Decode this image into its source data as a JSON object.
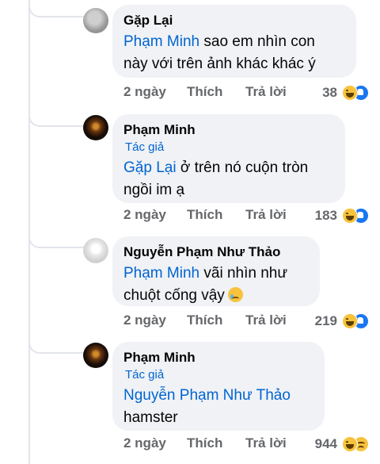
{
  "comments": [
    {
      "author": "Gặp Lại",
      "mention": "Phạm Minh",
      "text_line1": " sao em nhìn con",
      "text_line2": "này với trên ảnh khác khác ý",
      "time": "2 ngày",
      "like_label": "Thích",
      "reply_label": "Trả lời",
      "reaction_count": "38",
      "reactions": [
        "haha-icon",
        "like-icon"
      ]
    },
    {
      "author": "Phạm Minh",
      "author_tag": "Tác giả",
      "mention": "Gặp Lại",
      "text_line1": " ở trên nó cuộn tròn",
      "text_line2": "ngồi im ạ",
      "time": "2 ngày",
      "like_label": "Thích",
      "reply_label": "Trả lời",
      "reaction_count": "183",
      "reactions": [
        "haha-icon",
        "like-icon"
      ]
    },
    {
      "author": "Nguyễn Phạm Như Thảo",
      "mention": "Phạm Minh",
      "text_line1": " vãi nhìn như",
      "text_line2": "chuột cống vậy",
      "emoji": "crying-face-icon",
      "time": "2 ngày",
      "like_label": "Thích",
      "reply_label": "Trả lời",
      "reaction_count": "219",
      "reactions": [
        "haha-icon",
        "like-icon"
      ]
    },
    {
      "author": "Phạm Minh",
      "author_tag": "Tác giả",
      "mention": "Nguyễn Phạm Như Thảo",
      "text_line2": "hamster",
      "time": "2 ngày",
      "like_label": "Thích",
      "reply_label": "Trả lời",
      "reaction_count": "944",
      "reactions": [
        "haha-icon",
        "sad-icon"
      ]
    }
  ],
  "colors": {
    "bubble": "#f0f2f5",
    "mention": "#0064d1",
    "meta": "#65676b",
    "like_blue": "#1877f2",
    "emoji_yellow": "#f7c33c"
  }
}
